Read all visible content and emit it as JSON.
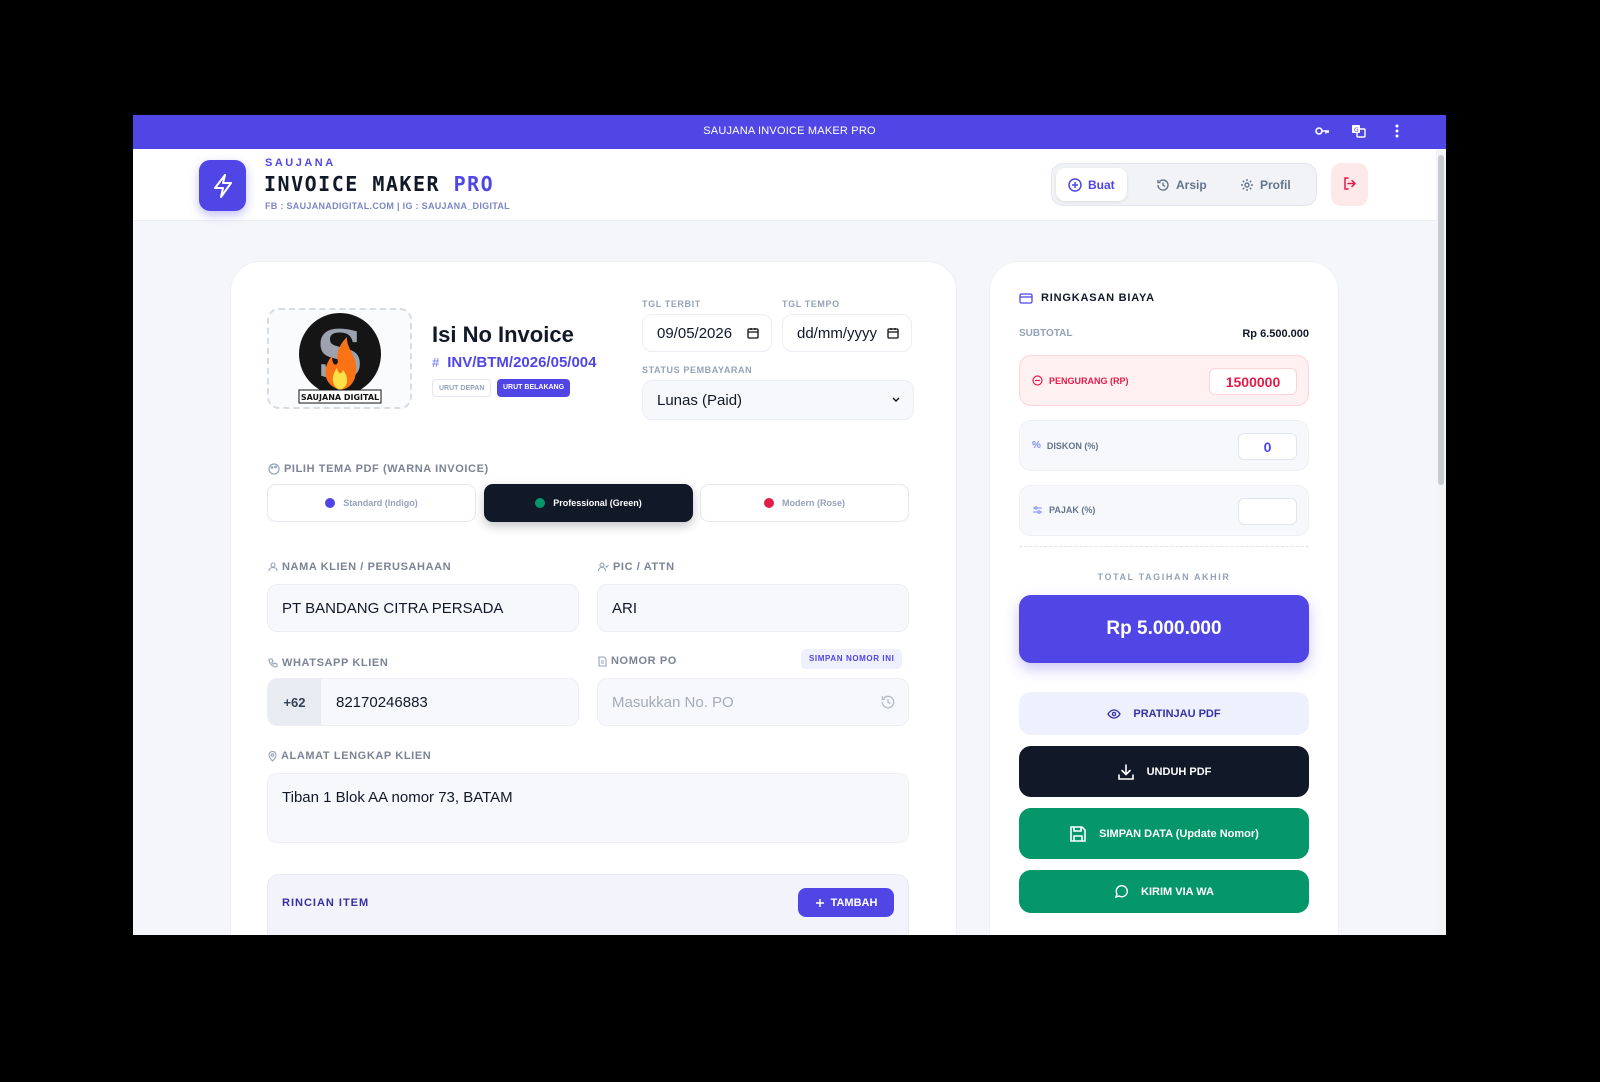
{
  "window": {
    "title": "SAUJANA INVOICE MAKER PRO"
  },
  "brand": {
    "sub": "SAUJANA",
    "title_main": "INVOICE MAKER",
    "title_accent": "PRO",
    "meta": "FB : SAUJANADIGITAL.COM | IG : SAUJANA_DIGITAL"
  },
  "nav": {
    "tabs": [
      {
        "label": "Buat",
        "icon": "plus-circle-icon",
        "active": true
      },
      {
        "label": "Arsip",
        "icon": "history-icon",
        "active": false
      },
      {
        "label": "Profil",
        "icon": "gear-icon",
        "active": false
      }
    ]
  },
  "invoice": {
    "logo_caption": "SAUJANA DIGITAL",
    "title": "Isi No Invoice",
    "hash": "#",
    "number": "INV/BTM/2026/05/004",
    "order_options": [
      "URUT DEPAN",
      "URUT BELAKANG"
    ],
    "order_selected": "URUT BELAKANG",
    "issue_date_label": "TGL TERBIT",
    "issue_date": "09/05/2026",
    "due_date_label": "TGL TEMPO",
    "due_date_placeholder": "dd/mm/yyyy",
    "status_label": "STATUS PEMBAYARAN",
    "status_value": "Lunas (Paid)"
  },
  "theme": {
    "label": "PILIH TEMA PDF (WARNA INVOICE)",
    "options": [
      {
        "label": "Standard (Indigo)",
        "color": "#4f46e5",
        "active": false
      },
      {
        "label": "Professional (Green)",
        "color": "#059669",
        "active": true
      },
      {
        "label": "Modern (Rose)",
        "color": "#e11d48",
        "active": false
      }
    ]
  },
  "client": {
    "name_label": "NAMA KLIEN / PERUSAHAAN",
    "name_value": "PT BANDANG CITRA PERSADA",
    "pic_label": "PIC / ATTN",
    "pic_value": "ARI",
    "wa_label": "WHATSAPP KLIEN",
    "wa_prefix": "+62",
    "wa_value": "82170246883",
    "po_label": "NOMOR PO",
    "po_save": "SIMPAN NOMOR INI",
    "po_placeholder": "Masukkan No. PO",
    "address_label": "ALAMAT LENGKAP KLIEN",
    "address_value": "Tiban 1 Blok AA nomor 73, BATAM"
  },
  "items": {
    "title": "RINCIAN ITEM",
    "add_label": "TAMBAH"
  },
  "summary": {
    "title": "RINGKASAN BIAYA",
    "subtotal_label": "SUBTOTAL",
    "subtotal_value": "Rp 6.500.000",
    "deduction_label": "PENGURANG (RP)",
    "deduction_value": "1500000",
    "discount_label": "DISKON (%)",
    "discount_value": "0",
    "tax_label": "PAJAK (%)",
    "tax_value": "",
    "total_label": "TOTAL TAGIHAN AKHIR",
    "total_value": "Rp 5.000.000",
    "preview_label": "PRATINJAU PDF",
    "download_label": "UNDUH PDF",
    "save_label": "SIMPAN DATA (Update Nomor)",
    "wa_label": "KIRIM VIA WA"
  },
  "colors": {
    "accent": "#4f46e5",
    "dark": "#111827",
    "green": "#059669",
    "rose": "#e11d48"
  }
}
